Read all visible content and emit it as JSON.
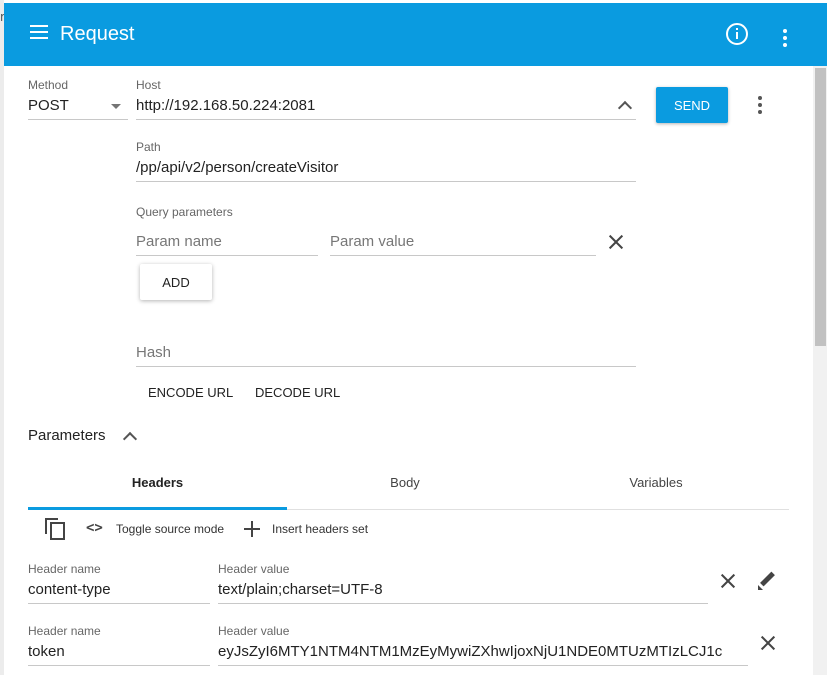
{
  "app": {
    "title": "Request"
  },
  "edge": {
    "mark": "m"
  },
  "icons": {
    "menu": "menu-icon",
    "info": "info-icon",
    "more": "more-vert-icon",
    "dropdown": "arrow-drop-down-icon",
    "collapse": "chevron-up-icon",
    "clear": "close-icon",
    "copy": "copy-icon",
    "code": "code-icon",
    "add": "plus-icon",
    "edit": "pencil-icon"
  },
  "colors": {
    "primary": "#0a9be0"
  },
  "method": {
    "label": "Method",
    "value": "POST"
  },
  "host": {
    "label": "Host",
    "value": "http://192.168.50.224:2081"
  },
  "send": {
    "label": "SEND"
  },
  "path": {
    "label": "Path",
    "value": "/pp/api/v2/person/createVisitor"
  },
  "query": {
    "label": "Query parameters",
    "name_placeholder": "Param name",
    "value_placeholder": "Param value",
    "add_label": "ADD"
  },
  "hash": {
    "placeholder": "Hash"
  },
  "url_actions": {
    "encode": "ENCODE URL",
    "decode": "DECODE URL"
  },
  "parameters": {
    "title": "Parameters",
    "tabs": [
      {
        "label": "Headers",
        "active": true
      },
      {
        "label": "Body",
        "active": false
      },
      {
        "label": "Variables",
        "active": false
      }
    ],
    "toolbar": {
      "toggle_source": "Toggle source mode",
      "insert_set": "Insert headers set"
    },
    "headers": [
      {
        "name_label": "Header name",
        "name": "content-type",
        "value_label": "Header value",
        "value": "text/plain;charset=UTF-8"
      },
      {
        "name_label": "Header name",
        "name": "token",
        "value_label": "Header value",
        "value": "eyJsZyI6MTY1NTM4NTM1MzEyMywiZXhwIjoxNjU1NDE0MTUzMTIzLCJ1c"
      }
    ]
  }
}
